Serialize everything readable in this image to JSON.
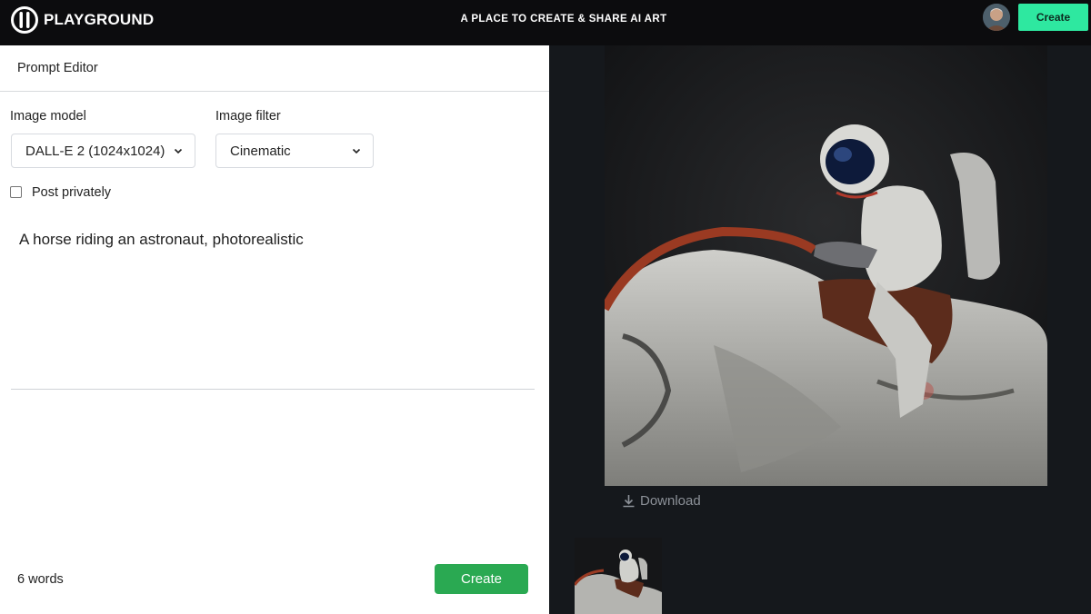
{
  "app": {
    "brand": "PLAYGROUND",
    "tagline": "A PLACE TO CREATE & SHARE AI ART",
    "top_create_label": "Create",
    "accent_color": "#2ee8a0"
  },
  "editor": {
    "title": "Prompt Editor",
    "image_model": {
      "label": "Image model",
      "value": "DALL-E 2 (1024x1024)"
    },
    "image_filter": {
      "label": "Image filter",
      "value": "Cinematic"
    },
    "post_privately": {
      "label": "Post privately",
      "checked": false
    },
    "prompt": "A horse riding an astronaut, photorealistic",
    "word_count": "6 words",
    "create_label": "Create",
    "create_color": "#2aa952"
  },
  "result": {
    "download_label": "Download",
    "icons": [
      "download-icon",
      "chevron-down-icon",
      "logo-icon"
    ]
  }
}
